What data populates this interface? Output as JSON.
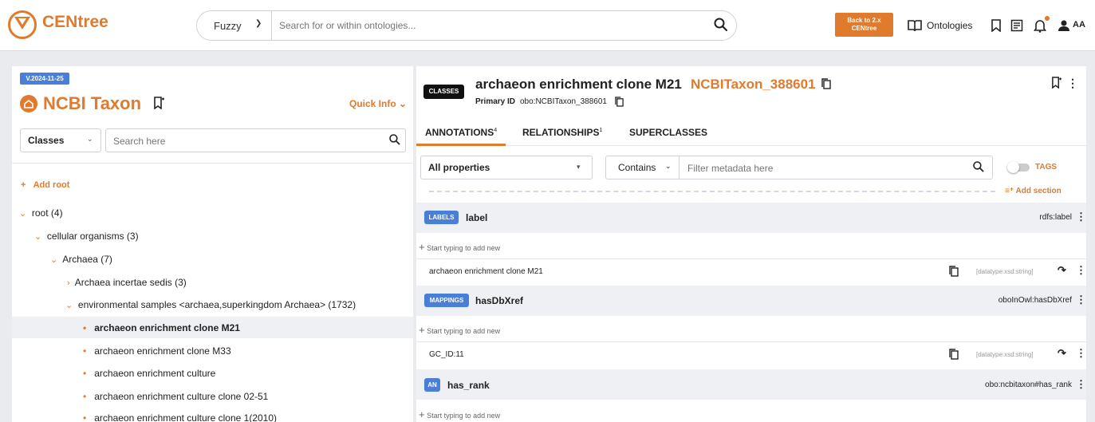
{
  "header": {
    "logo_text": "CENtree",
    "search_mode": "Fuzzy",
    "search_placeholder": "Search for or within ontologies...",
    "back_button": [
      "Back to 2.x",
      "CENtree"
    ],
    "ontologies_label": "Ontologies",
    "user_initials": "AA",
    "accent_color": "#e07a2c"
  },
  "left": {
    "version": "V.2024-11-25",
    "ontology_title": "NCBI Taxon",
    "quick_info": "Quick Info",
    "type_select": "Classes",
    "search_placeholder": "Search here",
    "add_root": "Add root",
    "tree": [
      {
        "label": "root (4)",
        "level": 0,
        "state": "expanded"
      },
      {
        "label": "cellular organisms (3)",
        "level": 1,
        "state": "expanded"
      },
      {
        "label": "Archaea (7)",
        "level": 2,
        "state": "expanded"
      },
      {
        "label": "Archaea incertae sedis (3)",
        "level": 3,
        "state": "collapsed"
      },
      {
        "label": "environmental samples <archaea,superkingdom Archaea> (1732)",
        "level": 3,
        "state": "expanded"
      },
      {
        "label": "archaeon enrichment clone M21",
        "level": 4,
        "state": "leaf",
        "selected": true
      },
      {
        "label": "archaeon enrichment clone M33",
        "level": 4,
        "state": "leaf"
      },
      {
        "label": "archaeon enrichment culture",
        "level": 4,
        "state": "leaf"
      },
      {
        "label": "archaeon enrichment culture clone 02-51",
        "level": 4,
        "state": "leaf"
      },
      {
        "label": "archaeon enrichment culture clone 1(2010)",
        "level": 4,
        "state": "leaf"
      }
    ]
  },
  "right": {
    "type_badge": "CLASSES",
    "term_title": "archaeon enrichment clone M21",
    "term_id": "NCBITaxon_388601",
    "primary_id_label": "Primary ID",
    "primary_id_value": "obo:NCBITaxon_388601",
    "tabs": [
      {
        "label": "ANNOTATIONS",
        "count": "4"
      },
      {
        "label": "RELATIONSHIPS",
        "count": "1"
      },
      {
        "label": "SUPERCLASSES",
        "count": ""
      }
    ],
    "property_select": "All properties",
    "filter_mode": "Contains",
    "filter_placeholder": "Filter metadata here",
    "tags_label": "TAGS",
    "add_section": "Add section",
    "add_new_placeholder": "Start typing to add new",
    "sections": [
      {
        "badge": "LABELS",
        "title": "label",
        "predicate": "rdfs:label",
        "value": "archaeon enrichment clone M21",
        "datatype": "[datatype:xsd:string]"
      },
      {
        "badge": "MAPPINGS",
        "title": "hasDbXref",
        "predicate": "oboInOwl:hasDbXref",
        "value": "GC_ID:11",
        "datatype": "[datatype:xsd:string]"
      },
      {
        "badge": "AN",
        "title": "has_rank",
        "predicate": "obo:ncbitaxon#has_rank"
      }
    ]
  }
}
